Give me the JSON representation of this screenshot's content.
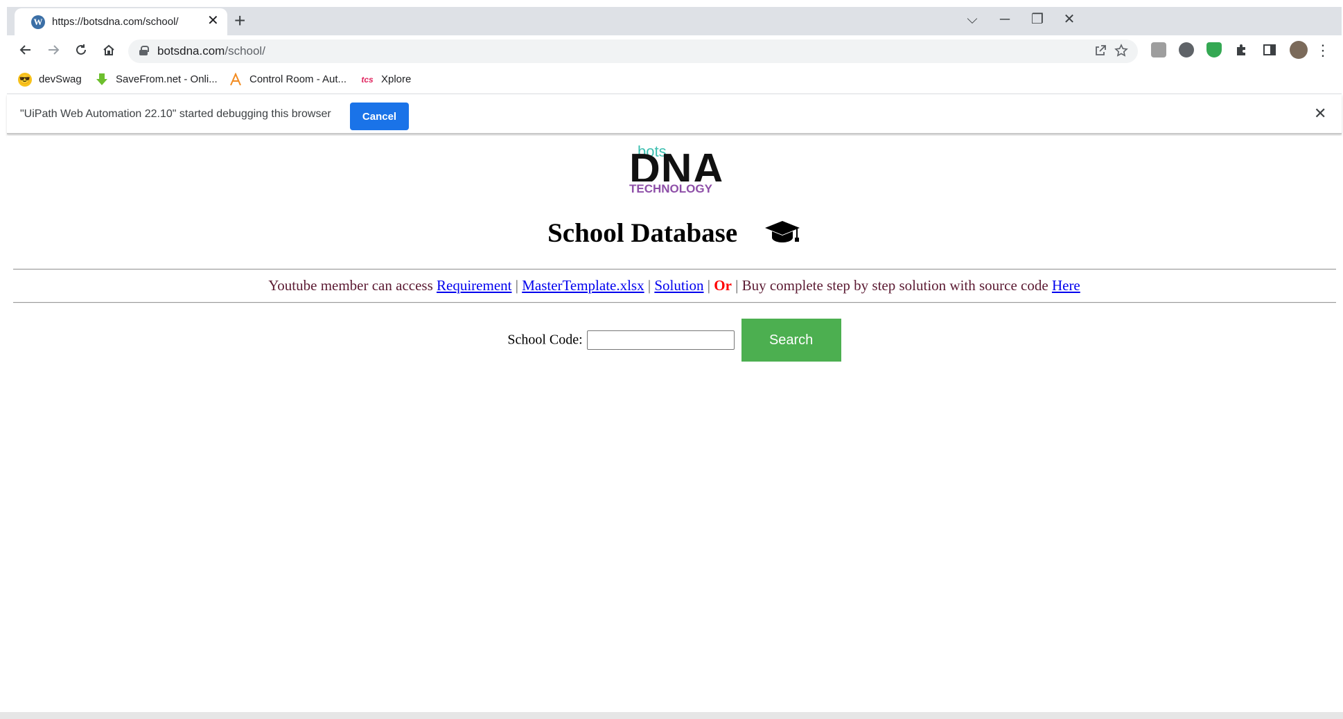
{
  "browser": {
    "tab_title": "https://botsdna.com/school/",
    "tab_favicon": "W",
    "tab_close_glyph": "✕",
    "new_tab_glyph": "+",
    "url_host": "botsdna.com",
    "url_path": "/school/",
    "window_controls": {
      "dropdown": "⌵",
      "minimize": "─",
      "restore": "❐",
      "close": "✕"
    },
    "bookmarks": [
      {
        "label": "devSwag",
        "icon": "sunglasses-emoji-icon"
      },
      {
        "label": "SaveFrom.net - Onli...",
        "icon": "download-arrow-icon"
      },
      {
        "label": "Control Room - Aut...",
        "icon": "automation-anywhere-icon"
      },
      {
        "label": "Xplore",
        "icon": "tcs-icon"
      }
    ],
    "infobar": {
      "message": "\"UiPath Web Automation 22.10\" started debugging this browser",
      "cancel_label": "Cancel",
      "close_glyph": "✕"
    }
  },
  "page": {
    "logo": {
      "line1": "bots",
      "line2": "DNA",
      "line3": "TECHNOLOGY"
    },
    "title": "School Database",
    "links_line": {
      "lead": "Youtube member can access",
      "link1": "Requirement",
      "link2": "MasterTemplate.xlsx",
      "link3": "Solution",
      "or_text": "Or",
      "middle": "Buy complete step by step solution with source code",
      "link4": "Here",
      "separator": "|"
    },
    "search": {
      "label": "School Code:",
      "input_value": "",
      "button_label": "Search"
    }
  },
  "colors": {
    "accent_blue": "#1a73e8",
    "search_green": "#4caf50",
    "link_blue": "#0000ee",
    "or_red": "#ff0000"
  }
}
